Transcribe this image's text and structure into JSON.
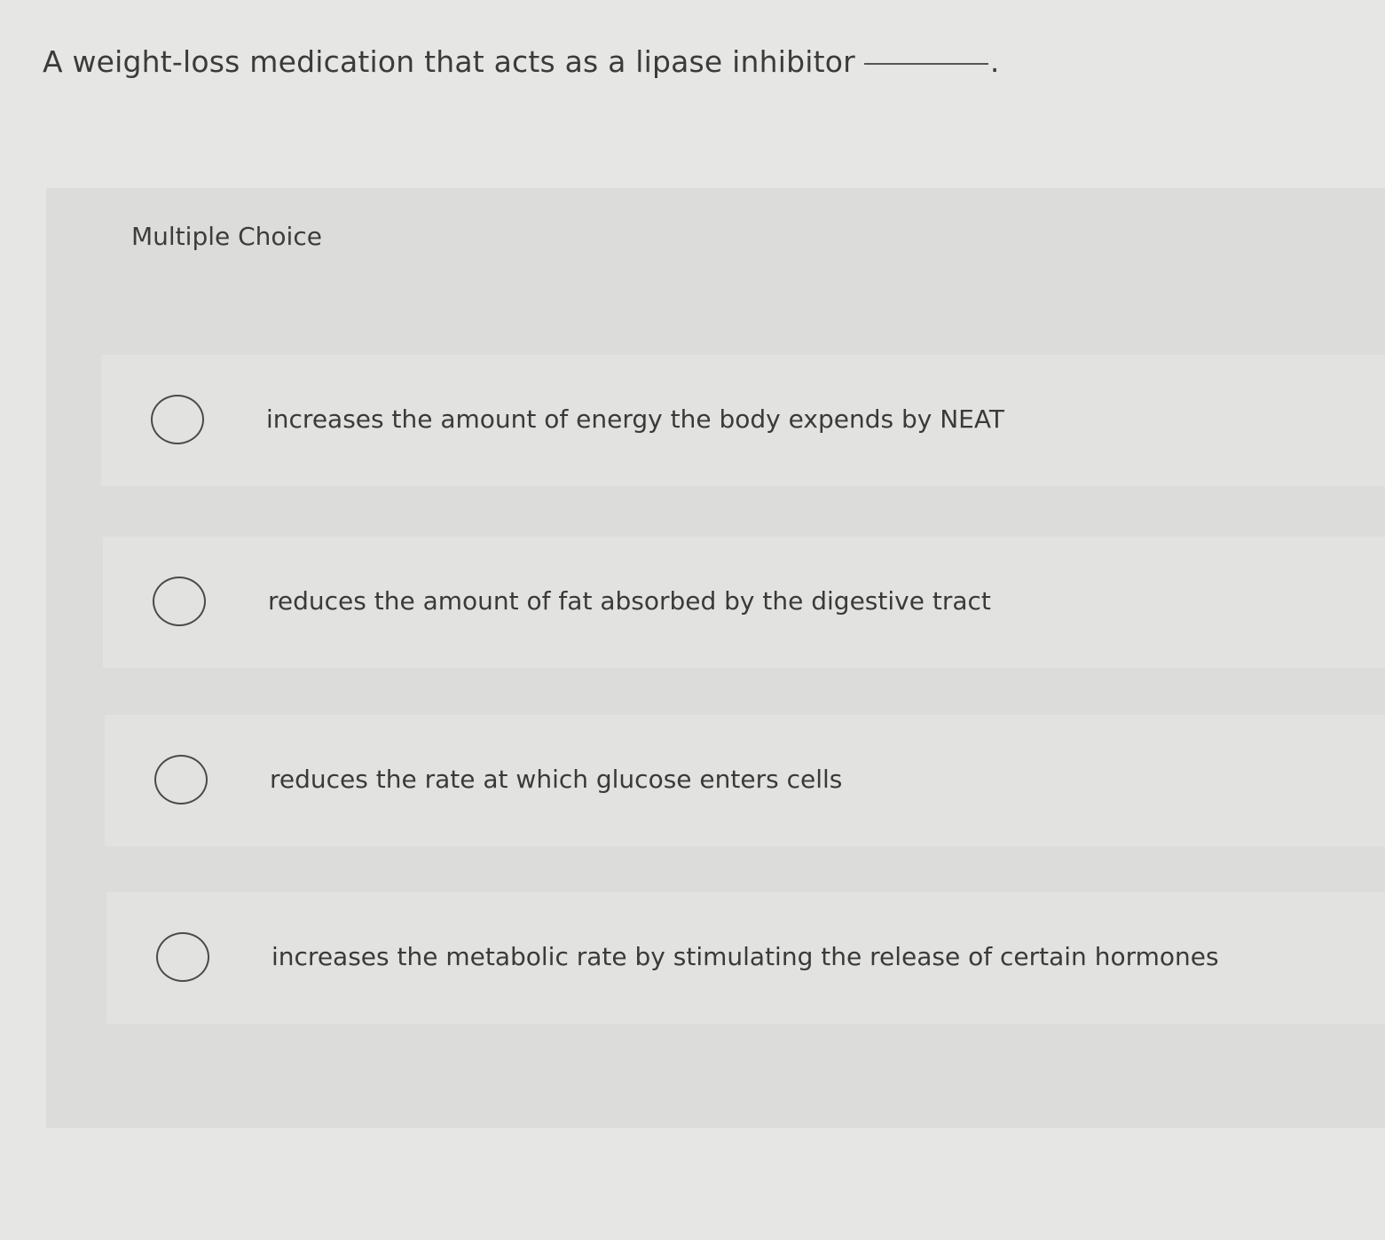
{
  "question": {
    "text": "A weight-loss medication that acts as a lipase inhibitor",
    "end_punctuation": "."
  },
  "multiple_choice": {
    "header": "Multiple Choice",
    "options": [
      {
        "label": "increases the amount of energy the body expends by NEAT",
        "selected": false
      },
      {
        "label": "reduces the amount of fat absorbed by the digestive tract",
        "selected": false
      },
      {
        "label": "reduces the rate at which glucose enters cells",
        "selected": false
      },
      {
        "label": "increases the metabolic rate by stimulating the release of certain hormones",
        "selected": false
      }
    ]
  }
}
